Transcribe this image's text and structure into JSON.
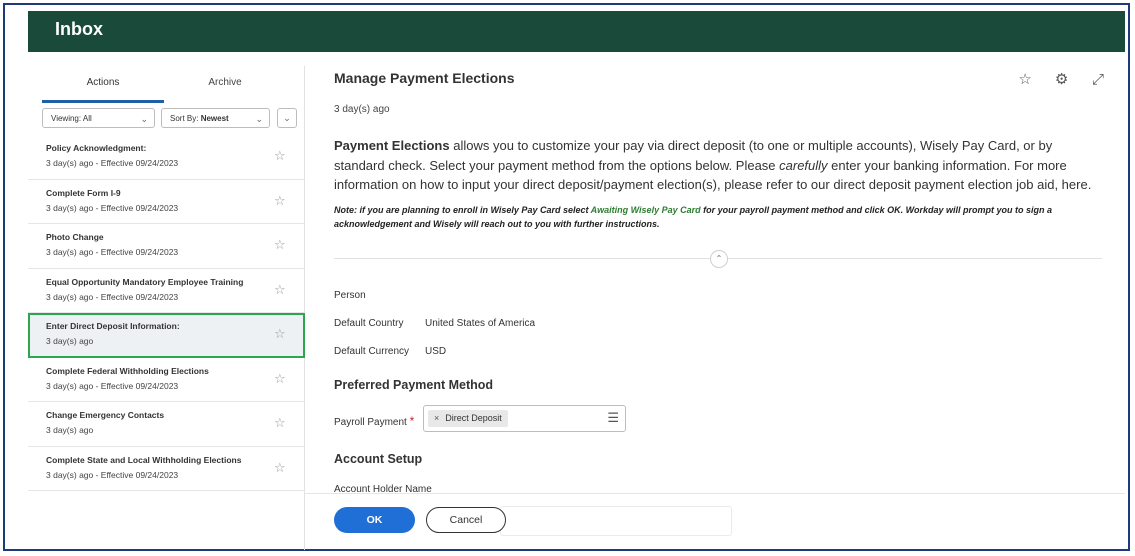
{
  "header": {
    "title": "Inbox"
  },
  "tabs": {
    "actions": "Actions",
    "archive": "Archive"
  },
  "filters": {
    "viewing_label": "Viewing:",
    "viewing_value": "All",
    "sort_label": "Sort By:",
    "sort_value": "Newest"
  },
  "inbox_items": [
    {
      "title": "Policy Acknowledgment:",
      "subtitle": "3 day(s) ago - Effective 09/24/2023"
    },
    {
      "title": "Complete Form I-9",
      "subtitle": "3 day(s) ago - Effective 09/24/2023"
    },
    {
      "title": "Photo Change",
      "subtitle": "3 day(s) ago - Effective 09/24/2023"
    },
    {
      "title": "Equal Opportunity Mandatory Employee Training",
      "subtitle": "3 day(s) ago - Effective 09/24/2023"
    },
    {
      "title": "Enter Direct Deposit Information:",
      "subtitle": "3 day(s) ago"
    },
    {
      "title": "Complete Federal Withholding Elections",
      "subtitle": "3 day(s) ago - Effective 09/24/2023"
    },
    {
      "title": "Change Emergency Contacts",
      "subtitle": "3 day(s) ago"
    },
    {
      "title": "Complete State and Local Withholding Elections",
      "subtitle": "3 day(s) ago - Effective 09/24/2023"
    }
  ],
  "main": {
    "title": "Manage Payment Elections",
    "age": "3 day(s) ago",
    "intro_bold": "Payment Elections",
    "intro_part1": " allows you to customize your pay via direct deposit (to one or multiple accounts), Wisely Pay Card, or by standard check. Select your payment method from the options below. Please ",
    "intro_italic": "carefully",
    "intro_part2": " enter your banking information. For more information on how to input your direct deposit/payment election(s), please refer to our direct deposit payment election job aid, here.",
    "note_part1": "Note: if you are planning to enroll in Wisely Pay Card select ",
    "note_green": "Awaiting Wisely Pay Card",
    "note_part2": " for your payroll payment method and click OK. Workday will prompt you to sign a acknowledgement and Wisely will reach out to you with further instructions.",
    "person_label": "Person",
    "country_label": "Default Country",
    "country_value": "United States of America",
    "currency_label": "Default Currency",
    "currency_value": "USD",
    "preferred_heading": "Preferred Payment Method",
    "payroll_label": "Payroll Payment",
    "payroll_required": "*",
    "payroll_value": "Direct Deposit",
    "account_heading": "Account Setup",
    "account_holder_label": "Account Holder Name"
  },
  "footer": {
    "ok_label": "OK",
    "cancel_label": "Cancel"
  },
  "colors": {
    "header": "#1a4a3a",
    "accent": "#1f6fd6",
    "selected_border": "#2da44e",
    "note_green": "#2e7d32"
  }
}
